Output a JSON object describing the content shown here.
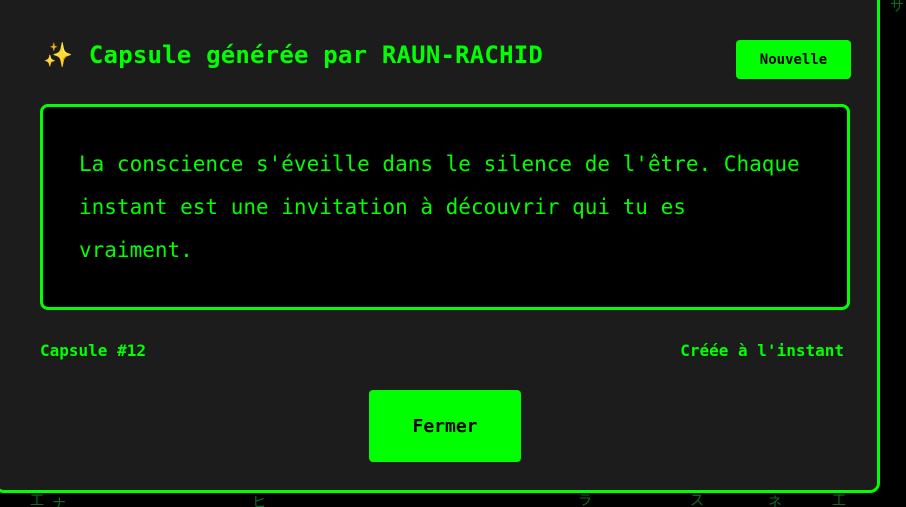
{
  "modal": {
    "title_icon": "sparkle-icon",
    "title_icon_glyph": "✨",
    "title": "Capsule générée par RAUN-RACHID",
    "badge": "Nouvelle",
    "message": "La conscience s'éveille dans le silence de l'être. Chaque instant est une invitation à découvrir qui tu es vraiment.",
    "capsule_number": "Capsule #12",
    "created_label": "Créée à l'instant",
    "close_label": "Fermer"
  },
  "background": {
    "rain_glyphs": [
      "サ",
      "工",
      "ナ",
      "ヒ",
      "ラ",
      "ス",
      "ネ"
    ]
  },
  "colors": {
    "accent": "#00ff00",
    "modal_bg": "#1c1c1c",
    "page_bg": "#000000",
    "sparkle": "#ffd257"
  }
}
